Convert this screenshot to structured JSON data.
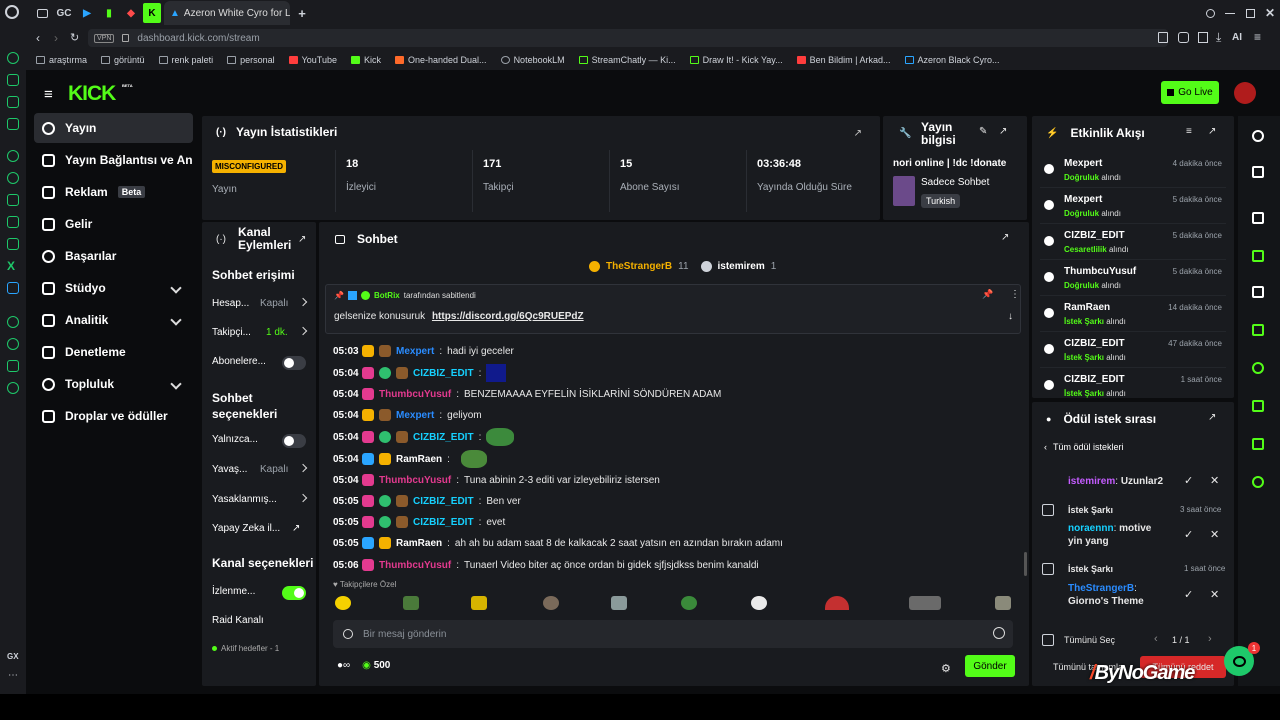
{
  "browser": {
    "tab_icons": [
      "GC"
    ],
    "active_tab_title": "Azeron White Cyro for Lefties",
    "url": "dashboard.kick.com/stream",
    "vpn_label": "VPN",
    "ai_label": "AI",
    "gx_label": "GX",
    "bookmarks": [
      "araştırma",
      "görüntü",
      "renk paleti",
      "personal",
      "YouTube",
      "Kick",
      "One-handed Dual...",
      "NotebookLM",
      "StreamChatly — Ki...",
      "Draw It! - Kick Yay...",
      "Ben Bildim | Arkad...",
      "Azeron Black Cyro..."
    ]
  },
  "kick": {
    "logo": "KICK",
    "beta_tag": "BETA",
    "go_live": "Go Live",
    "nav": [
      {
        "label": "Yayın"
      },
      {
        "label": "Yayın Bağlantısı ve Anahtar"
      },
      {
        "label": "Reklam",
        "badge": "Beta"
      },
      {
        "label": "Gelir"
      },
      {
        "label": "Başarılar"
      },
      {
        "label": "Stüdyo"
      },
      {
        "label": "Analitik"
      },
      {
        "label": "Denetleme"
      },
      {
        "label": "Topluluk"
      },
      {
        "label": "Droplar ve ödüller"
      }
    ],
    "stats": {
      "title": "Yayın İstatistikleri",
      "items": [
        {
          "value": "MISCONFIGURED",
          "label": "Yayın"
        },
        {
          "value": "18",
          "label": "İzleyici"
        },
        {
          "value": "171",
          "label": "Takipçi"
        },
        {
          "value": "15",
          "label": "Abone Sayısı"
        },
        {
          "value": "03:36:48",
          "label": "Yayında Olduğu Süre"
        }
      ]
    },
    "stream_info": {
      "title": "Yayın bilgisi",
      "stream_title": "nori online | !dc !donate",
      "category": "Sadece Sohbet",
      "tag": "Turkish"
    },
    "events": {
      "title": "Etkinlik Akışı",
      "items": [
        {
          "user": "Mexpert",
          "type": "Doğruluk",
          "suffix": "alındı",
          "time": "4 dakika önce"
        },
        {
          "user": "Mexpert",
          "type": "Doğruluk",
          "suffix": "alındı",
          "time": "5 dakika önce"
        },
        {
          "user": "CIZBIZ_EDIT",
          "type": "Cesaretlilik",
          "suffix": "alındı",
          "time": "5 dakika önce"
        },
        {
          "user": "ThumbcuYusuf",
          "type": "Doğruluk",
          "suffix": "alındı",
          "time": "5 dakika önce"
        },
        {
          "user": "RamRaen",
          "type": "İstek Şarkı",
          "suffix": "alındı",
          "time": "14 dakika önce"
        },
        {
          "user": "CIZBIZ_EDIT",
          "type": "İstek Şarkı",
          "suffix": "alındı",
          "time": "47 dakika önce"
        },
        {
          "user": "CIZBIZ_EDIT",
          "type": "İstek Şarkı",
          "suffix": "alındı",
          "time": "1 saat önce"
        }
      ]
    },
    "actions": {
      "title": "Kanal Eylemleri",
      "chat_access": "Sohbet erişimi",
      "options_a": [
        {
          "label": "Hesap...",
          "value": "Kapalı"
        },
        {
          "label": "Takipçi...",
          "value": "1 dk."
        },
        {
          "label": "Abonelere..."
        }
      ],
      "chat_options": "Sohbet seçenekleri",
      "options_b": [
        {
          "label": "Yalnızca..."
        },
        {
          "label": "Yavaş...",
          "value": "Kapalı"
        },
        {
          "label": "Yasaklanmış..."
        },
        {
          "label": "Yapay Zeka il..."
        }
      ],
      "channel_options": "Kanal seçenekleri",
      "options_c": [
        {
          "label": "İzlenme..."
        },
        {
          "label": "Raid Kanalı"
        }
      ],
      "active_goals": "Aktif hedefler - 1"
    },
    "chat": {
      "title": "Sohbet",
      "top_users": [
        {
          "name": "TheStrangerB",
          "count": "11"
        },
        {
          "name": "istemirem",
          "count": "1"
        }
      ],
      "pinned_by": "BotRix",
      "pinned_suffix": "tarafından sabitlendi",
      "pinned_text": "gelsenize konusuruk",
      "pinned_link": "https://discord.gg/6Qc9RUEPdZ",
      "messages": [
        {
          "time": "05:03",
          "user": "Mexpert",
          "color": "#2a8cff",
          "text": "hadi iyi geceler"
        },
        {
          "time": "05:04",
          "user": "CIZBIZ_EDIT",
          "color": "#16d1ff",
          "text": ""
        },
        {
          "time": "05:04",
          "user": "ThumbcuYusuf",
          "color": "#e33a8f",
          "text": "BENZEMAAAA EYFELİN İSİKLARİNİ SÖNDÜREN ADAM"
        },
        {
          "time": "05:04",
          "user": "Mexpert",
          "color": "#2a8cff",
          "text": "geliyom"
        },
        {
          "time": "05:04",
          "user": "CIZBIZ_EDIT",
          "color": "#16d1ff",
          "text": ""
        },
        {
          "time": "05:04",
          "user": "RamRaen",
          "color": "#ffffff",
          "text": ""
        },
        {
          "time": "05:04",
          "user": "ThumbcuYusuf",
          "color": "#e33a8f",
          "text": "Tuna abinin 2-3 editi var izleyebiliriz istersen"
        },
        {
          "time": "05:05",
          "user": "CIZBIZ_EDIT",
          "color": "#16d1ff",
          "text": "Ben ver"
        },
        {
          "time": "05:05",
          "user": "CIZBIZ_EDIT",
          "color": "#16d1ff",
          "text": "evet"
        },
        {
          "time": "05:05",
          "user": "RamRaen",
          "color": "#ffffff",
          "text": "ah ah bu adam saat 8 de kalkacak 2 saat yatsın en azından bırakın adamı"
        },
        {
          "time": "05:06",
          "user": "ThumbcuYusuf",
          "color": "#e33a8f",
          "text": "Tunaerl Video biter aç önce ordan bi gidek sjfjsjdkss benim kanaldi"
        }
      ],
      "followers_only": "Takipçilere Özel",
      "placeholder": "Bir mesaj gönderin",
      "points": "500",
      "send": "Gönder"
    },
    "rewards": {
      "title": "Ödül istek sırası",
      "back": "Tüm ödül istekleri",
      "requests": [
        {
          "reward": "",
          "user": "istemirem",
          "text": "Uzunlar2",
          "time": ""
        },
        {
          "reward": "İstek Şarkı",
          "user": "noraennn",
          "text": "motive yin yang",
          "time": "3 saat önce"
        },
        {
          "reward": "İstek Şarkı",
          "user": "TheStrangerB",
          "text": "Giorno's Theme",
          "time": "1 saat önce"
        }
      ],
      "select_all": "Tümünü Seç",
      "page": "1 / 1",
      "complete_all": "Tümünü tamamla",
      "reject_all": "Tümünü reddet"
    },
    "notification_count": "1",
    "watermark": "ByNoGame"
  }
}
